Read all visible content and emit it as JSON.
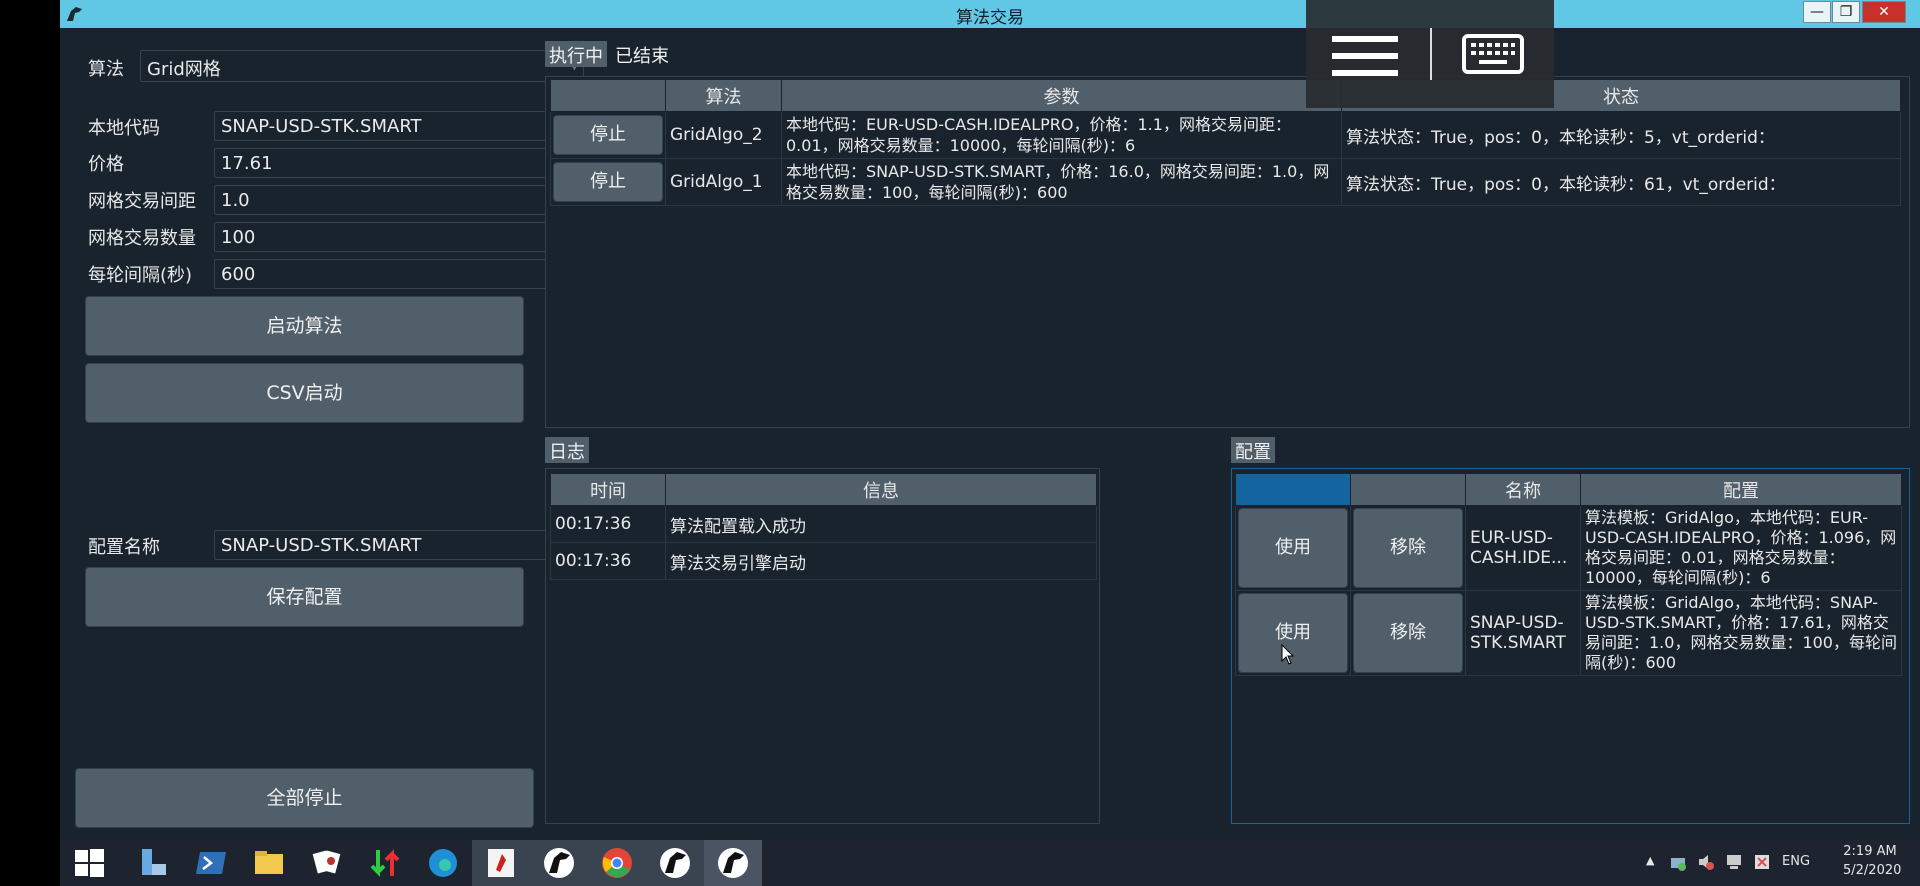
{
  "window": {
    "title": "算法交易"
  },
  "left": {
    "algo_label": "算法",
    "algo_value": "Grid网格",
    "fields": [
      {
        "label": "本地代码",
        "value": "SNAP-USD-STK.SMART"
      },
      {
        "label": "价格",
        "value": "17.61"
      },
      {
        "label": "网格交易间距",
        "value": "1.0"
      },
      {
        "label": "网格交易数量",
        "value": "100"
      },
      {
        "label": "每轮间隔(秒)",
        "value": "600"
      }
    ],
    "start_button": "启动算法",
    "csv_button": "CSV启动",
    "config_name_label": "配置名称",
    "config_name_value": "SNAP-USD-STK.SMART",
    "save_button": "保存配置",
    "stop_all_button": "全部停止"
  },
  "algo_tabs": [
    "执行中",
    "已结束"
  ],
  "active_table": {
    "headers": [
      "",
      "算法",
      "参数",
      "状态"
    ],
    "rows": [
      {
        "button": "停止",
        "algo": "GridAlgo_2",
        "params": "本地代码：EUR-USD-CASH.IDEALPRO，价格：1.1，网格交易间距：0.01，网格交易数量：10000，每轮间隔(秒)：6",
        "status": "算法状态：True，pos：0，本轮读秒：5，vt_orderid："
      },
      {
        "button": "停止",
        "algo": "GridAlgo_1",
        "params": "本地代码：SNAP-USD-STK.SMART，价格：16.0，网格交易间距：1.0，网格交易数量：100，每轮间隔(秒)：600",
        "status": "算法状态：True，pos：0，本轮读秒：61，vt_orderid："
      }
    ]
  },
  "log": {
    "tab": "日志",
    "headers": [
      "时间",
      "信息"
    ],
    "rows": [
      {
        "time": "00:17:36",
        "msg": "算法配置载入成功"
      },
      {
        "time": "00:17:36",
        "msg": "算法交易引擎启动"
      }
    ]
  },
  "config": {
    "tab": "配置",
    "headers": [
      "",
      "",
      "名称",
      "配置"
    ],
    "rows": [
      {
        "use": "使用",
        "remove": "移除",
        "name": "EUR-USD-CASH.IDE...",
        "setting": "算法模板：GridAlgo，本地代码：EUR-USD-CASH.IDEALPRO，价格：1.096，网格交易间距：0.01，网格交易数量：10000，每轮间隔(秒)：6"
      },
      {
        "use": "使用",
        "remove": "移除",
        "name": "SNAP-USD-STK.SMART",
        "setting": "算法模板：GridAlgo，本地代码：SNAP-USD-STK.SMART，价格：17.61，网格交易间距：1.0，网格交易数量：100，每轮间隔(秒)：600"
      }
    ]
  },
  "taskbar": {
    "icons": [
      "windows-start-icon",
      "server-manager-icon",
      "powershell-icon",
      "file-explorer-icon",
      "solitaire-icon",
      "transfer-arrows-icon",
      "edge-icon",
      "app-red-icon",
      "horse-app-icon",
      "chrome-icon",
      "horse-app-icon",
      "horse-app-icon"
    ],
    "language": "ENG",
    "time": "2:19 AM",
    "date": "5/2/2020"
  },
  "colors": {
    "titlebar": "#60c8e4",
    "background": "#19232d",
    "button": "#505f69",
    "selection": "#1464a0"
  }
}
